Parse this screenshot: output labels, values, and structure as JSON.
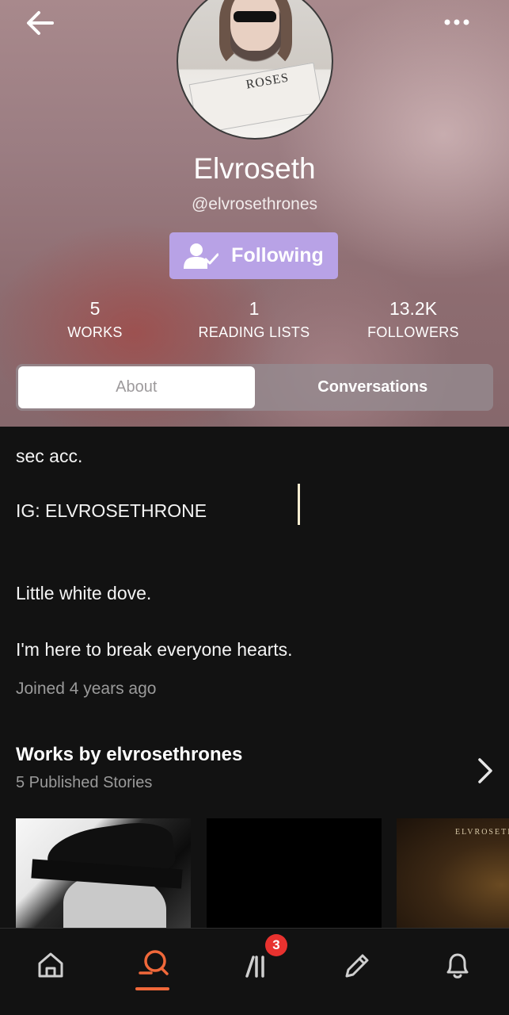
{
  "header": {
    "display_name": "Elvroseth",
    "username": "@elvrosethrones",
    "follow_button_label": "Following",
    "avatar_text": "ROSES"
  },
  "stats": [
    {
      "value": "5",
      "label": "WORKS"
    },
    {
      "value": "1",
      "label": "READING LISTS"
    },
    {
      "value": "13.2K",
      "label": "FOLLOWERS"
    }
  ],
  "tabs": [
    {
      "label": "About",
      "active": true
    },
    {
      "label": "Conversations",
      "active": false
    }
  ],
  "about": {
    "lines": [
      "sec acc.",
      "IG: ELVROSETHRONE",
      "Little white dove.",
      "I'm here to break everyone hearts."
    ],
    "joined": "Joined 4 years ago"
  },
  "works": {
    "title": "Works by elvrosethrones",
    "subtitle": "5 Published Stories",
    "cover3_title": "ELVROSETH"
  },
  "nav": {
    "items": [
      "home-icon",
      "search-icon",
      "library-icon",
      "write-icon",
      "notifications-icon"
    ],
    "library_badge": "3",
    "active": "search-icon"
  },
  "colors": {
    "accent": "#f0683a",
    "follow_button": "#b8a2e6",
    "badge": "#e8322f",
    "background": "#121212"
  }
}
